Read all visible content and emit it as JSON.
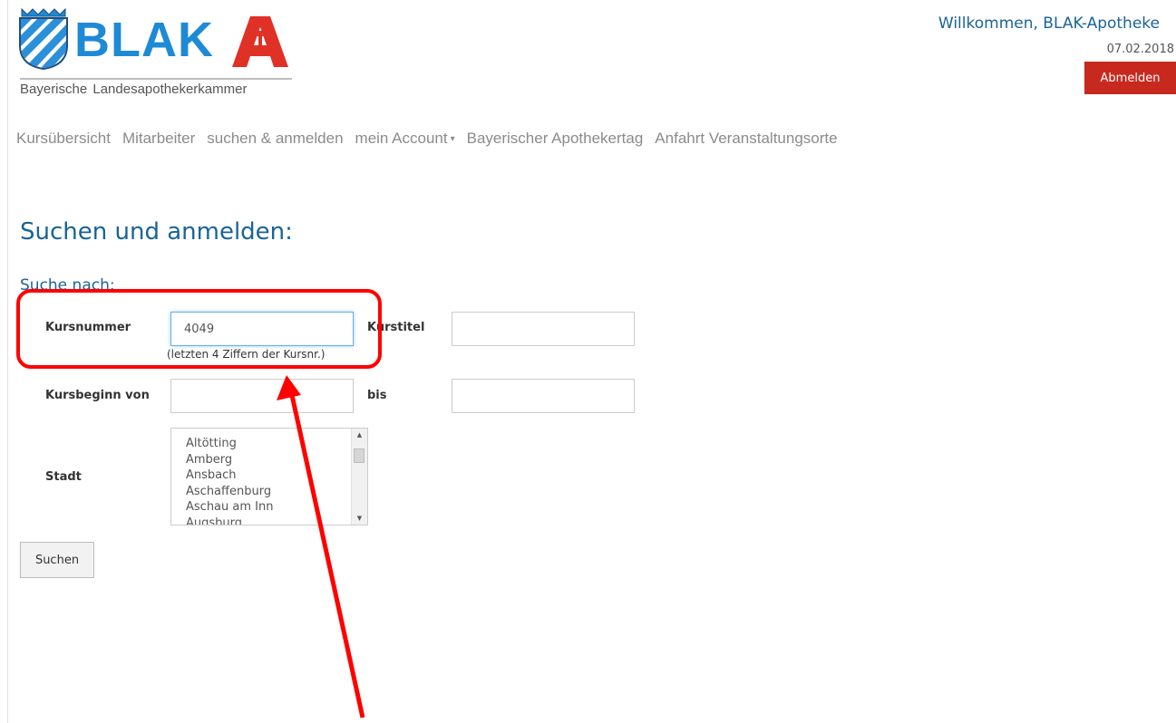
{
  "brand": {
    "logo_text": "BLAK",
    "subtitle": "Bayerische  Landesapothekerkammer"
  },
  "header": {
    "welcome": "Willkommen, BLAK-Apotheke",
    "date": "07.02.2018",
    "logout_label": "Abmelden"
  },
  "nav": {
    "items": [
      {
        "label": "Kursübersicht"
      },
      {
        "label": "Mitarbeiter"
      },
      {
        "label": "suchen & anmelden"
      },
      {
        "label": "mein Account",
        "has_dropdown": true
      },
      {
        "label": "Bayerischer Apothekertag"
      },
      {
        "label": "Anfahrt Veranstaltungsorte"
      }
    ]
  },
  "page": {
    "title": "Suchen und anmelden:",
    "section_title": "Suche nach:"
  },
  "form": {
    "kursnummer_label": "Kursnummer",
    "kursnummer_value": "4049",
    "kursnummer_hint": "(letzten 4 Ziffern der Kursnr.)",
    "kurstitel_label": "Kurstitel",
    "kurstitel_value": "",
    "kursbeginn_label": "Kursbeginn von",
    "kursbeginn_von_value": "",
    "bis_label": "bis",
    "kursbeginn_bis_value": "",
    "stadt_label": "Stadt",
    "stadt_options": [
      "Altötting",
      "Amberg",
      "Ansbach",
      "Aschaffenburg",
      "Aschau am Inn",
      "Augsburg"
    ],
    "search_label": "Suchen"
  },
  "colors": {
    "accent_blue": "#1a6496",
    "logout_red": "#c8291f",
    "annotation_red": "#ff0000",
    "logo_blue": "#1e8ad6"
  }
}
